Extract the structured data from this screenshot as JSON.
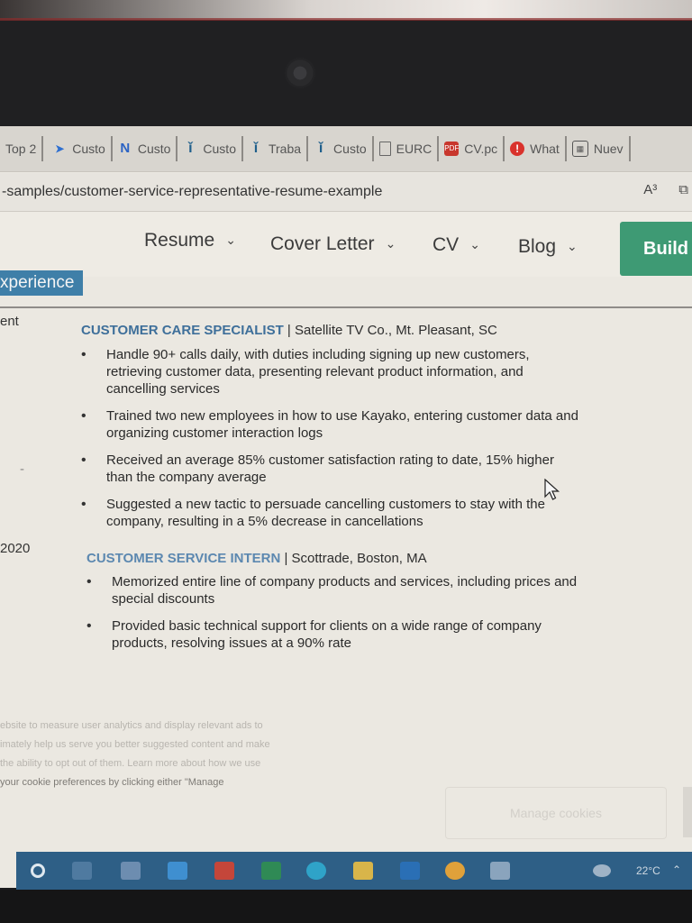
{
  "favorites": [
    {
      "label": "Top 2",
      "icon": "page-icon"
    },
    {
      "label": "Custo",
      "icon": "blue-arrow-icon"
    },
    {
      "label": "Custo",
      "icon": "n-logo-icon"
    },
    {
      "label": "Custo",
      "icon": "info-i-icon"
    },
    {
      "label": "Traba",
      "icon": "info-i-icon"
    },
    {
      "label": "Custo",
      "icon": "info-i-icon"
    },
    {
      "label": "EURC",
      "icon": "document-icon"
    },
    {
      "label": "CV.pc",
      "icon": "pdf-icon"
    },
    {
      "label": "What",
      "icon": "alert-icon"
    },
    {
      "label": "Nuev",
      "icon": "calendar-icon"
    }
  ],
  "address": {
    "url": "-samples/customer-service-representative-resume-example",
    "read_aloud": "A³",
    "collections": "⧉"
  },
  "nav": {
    "items": [
      {
        "label": "Resume"
      },
      {
        "label": "Cover Letter"
      },
      {
        "label": "CV"
      },
      {
        "label": "Blog"
      }
    ],
    "chevron": "⌄",
    "build": "Build"
  },
  "section": {
    "title": "xperience"
  },
  "jobs": [
    {
      "side": "ent",
      "role": "CUSTOMER CARE SPECIALIST",
      "company": " | Satellite TV Co., Mt. Pleasant, SC",
      "bullets": [
        "Handle 90+ calls daily, with duties including signing up new customers, retrieving customer data, presenting relevant product information, and cancelling services",
        "Trained two new employees in how to use Kayako, entering customer data and organizing customer interaction logs",
        "Received an average 85% customer satisfaction rating to date, 15% higher than the company average",
        "Suggested a new tactic to persuade cancelling customers to stay with the company, resulting in a 5% decrease in cancellations"
      ]
    },
    {
      "side": "2020",
      "role": "CUSTOMER SERVICE INTERN",
      "company": " | Scottrade, Boston, MA",
      "bullets": [
        "Memorized entire line of company products and services, including prices and special discounts",
        "Provided basic technical support for clients on a wide range of company products, resolving issues at a 90% rate"
      ]
    }
  ],
  "side_dash": "-",
  "cookie": {
    "lines": [
      "ebsite to measure user analytics and display relevant ads to",
      "imately help us serve you better suggested content and make",
      "the ability to opt out of them. Learn more about how we use",
      "your cookie preferences by clicking either \"Manage"
    ],
    "manage_button": "Manage cookies"
  },
  "taskbar": {
    "temperature": "22°C"
  }
}
